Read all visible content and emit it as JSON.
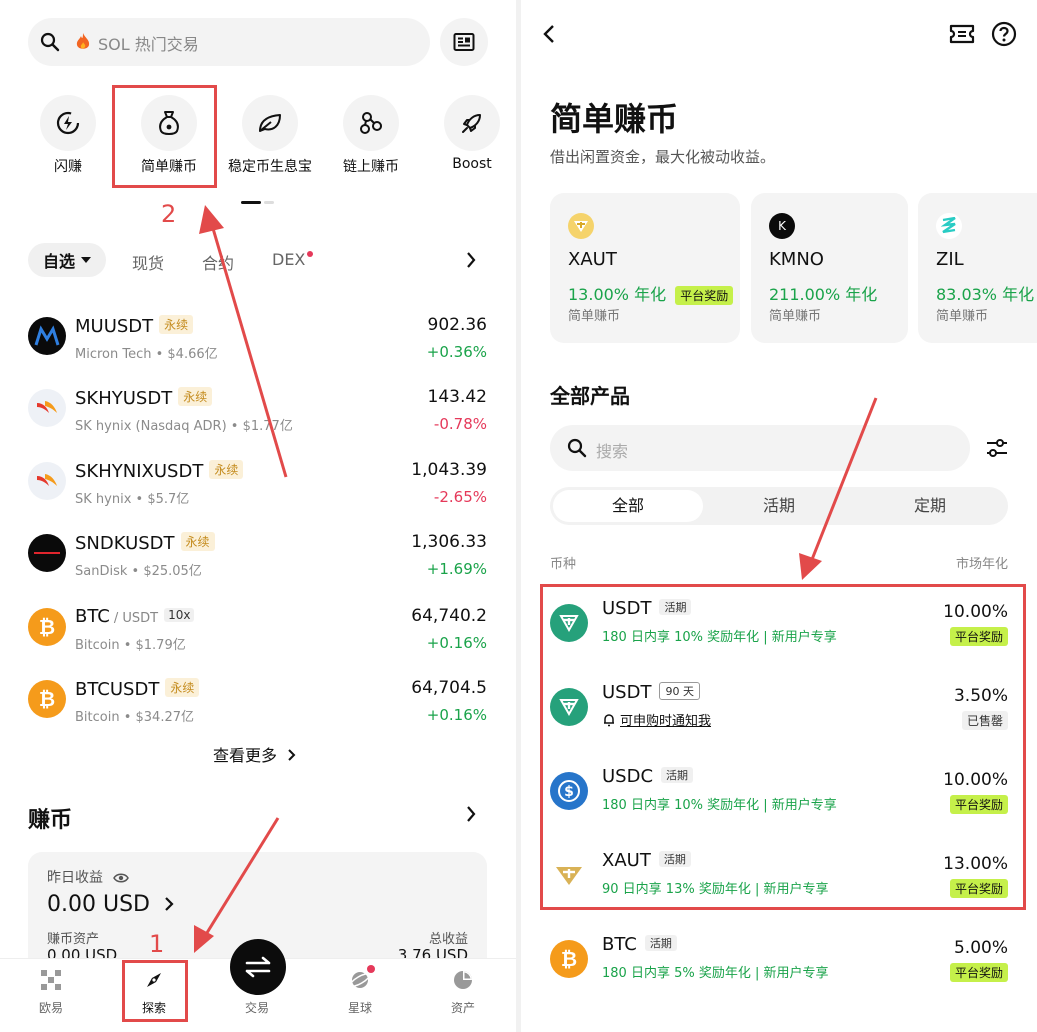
{
  "left": {
    "search": {
      "placeholder": "SOL 热门交易"
    },
    "quick_actions": [
      {
        "label": "闪赚",
        "icon": "flash-earn-icon"
      },
      {
        "label": "简单赚币",
        "icon": "money-bag-icon"
      },
      {
        "label": "稳定币生息宝",
        "icon": "leaf-icon"
      },
      {
        "label": "链上赚币",
        "icon": "nodes-icon"
      },
      {
        "label": "Boost",
        "icon": "rocket-icon"
      }
    ],
    "annotations": {
      "step1": "1",
      "step2": "2"
    },
    "market_tabs": {
      "selected": "自选",
      "items": [
        "现货",
        "合约",
        "DEX"
      ],
      "dex_badge_color": "#e5395a"
    },
    "market_rows": [
      {
        "symbol": "MUUSDT",
        "pair": "",
        "tag": "永续",
        "lev": "",
        "sub": "Micron Tech • $4.66亿",
        "price": "902.36",
        "change": "+0.36%",
        "dir": "up"
      },
      {
        "symbol": "SKHYUSDT",
        "pair": "",
        "tag": "永续",
        "lev": "",
        "sub": "SK hynix (Nasdaq ADR) • $1.77亿",
        "price": "143.42",
        "change": "-0.78%",
        "dir": "down"
      },
      {
        "symbol": "SKHYNIXUSDT",
        "pair": "",
        "tag": "永续",
        "lev": "",
        "sub": "SK hynix • $5.7亿",
        "price": "1,043.39",
        "change": "-2.65%",
        "dir": "down"
      },
      {
        "symbol": "SNDKUSDT",
        "pair": "",
        "tag": "永续",
        "lev": "",
        "sub": "SanDisk • $25.05亿",
        "price": "1,306.33",
        "change": "+1.69%",
        "dir": "up"
      },
      {
        "symbol": "BTC",
        "pair": "/ USDT",
        "tag": "",
        "lev": "10x",
        "sub": "Bitcoin • $1.79亿",
        "price": "64,740.2",
        "change": "+0.16%",
        "dir": "up"
      },
      {
        "symbol": "BTCUSDT",
        "pair": "",
        "tag": "永续",
        "lev": "",
        "sub": "Bitcoin • $34.27亿",
        "price": "64,704.5",
        "change": "+0.16%",
        "dir": "up"
      }
    ],
    "see_more": "查看更多",
    "earn": {
      "title": "赚币",
      "yesterday_label": "昨日收益",
      "yesterday_value": "0.00 USD",
      "assets_label": "赚币资产",
      "assets_value": "0.00 USD",
      "total_label": "总收益",
      "total_value": "3.76 USD"
    },
    "nav": [
      {
        "label": "欧易",
        "icon": "okx-logo-icon"
      },
      {
        "label": "探索",
        "icon": "compass-icon"
      },
      {
        "label": "交易",
        "icon": "swap-icon"
      },
      {
        "label": "星球",
        "icon": "planet-icon"
      },
      {
        "label": "资产",
        "icon": "pie-chart-icon"
      }
    ]
  },
  "right": {
    "title": "简单赚币",
    "subtitle": "借出闲置资金，最大化被动收益。",
    "featured": [
      {
        "name": "XAUT",
        "rate": "13.00% 年化",
        "badge": "平台奖励",
        "type": "简单赚币"
      },
      {
        "name": "KMNO",
        "rate": "211.00% 年化",
        "badge": "",
        "type": "简单赚币"
      },
      {
        "name": "ZIL",
        "rate": "83.03% 年化",
        "badge": "",
        "type": "简单赚币"
      }
    ],
    "all_products": "全部产品",
    "search_placeholder": "搜索",
    "segments": [
      "全部",
      "活期",
      "定期"
    ],
    "col_coin": "币种",
    "col_rate": "市场年化",
    "products": [
      {
        "name": "USDT",
        "tag": "活期",
        "tag_style": "fill",
        "desc": "180 日内享 10% 奖励年化 | 新用户专享",
        "rate": "10.00%",
        "badge": "平台奖励",
        "badge_style": "green",
        "logo": "tether"
      },
      {
        "name": "USDT",
        "tag": "90 天",
        "tag_style": "box",
        "desc": "可申购时通知我",
        "rate": "3.50%",
        "badge": "已售罄",
        "badge_style": "grey",
        "logo": "tether"
      },
      {
        "name": "USDC",
        "tag": "活期",
        "tag_style": "fill",
        "desc": "180 日内享 10% 奖励年化 | 新用户专享",
        "rate": "10.00%",
        "badge": "平台奖励",
        "badge_style": "green",
        "logo": "usdc"
      },
      {
        "name": "XAUT",
        "tag": "活期",
        "tag_style": "fill",
        "desc": "90 日内享 13% 奖励年化 | 新用户专享",
        "rate": "13.00%",
        "badge": "平台奖励",
        "badge_style": "green",
        "logo": "xaut"
      },
      {
        "name": "BTC",
        "tag": "活期",
        "tag_style": "fill",
        "desc": "180 日内享 5% 奖励年化 | 新用户专享",
        "rate": "5.00%",
        "badge": "平台奖励",
        "badge_style": "green",
        "logo": "btc"
      }
    ]
  },
  "colors": {
    "up": "#1aa34a",
    "down": "#e5395a",
    "highlight": "#e24a4a",
    "reward_badge": "#c5f04a"
  }
}
